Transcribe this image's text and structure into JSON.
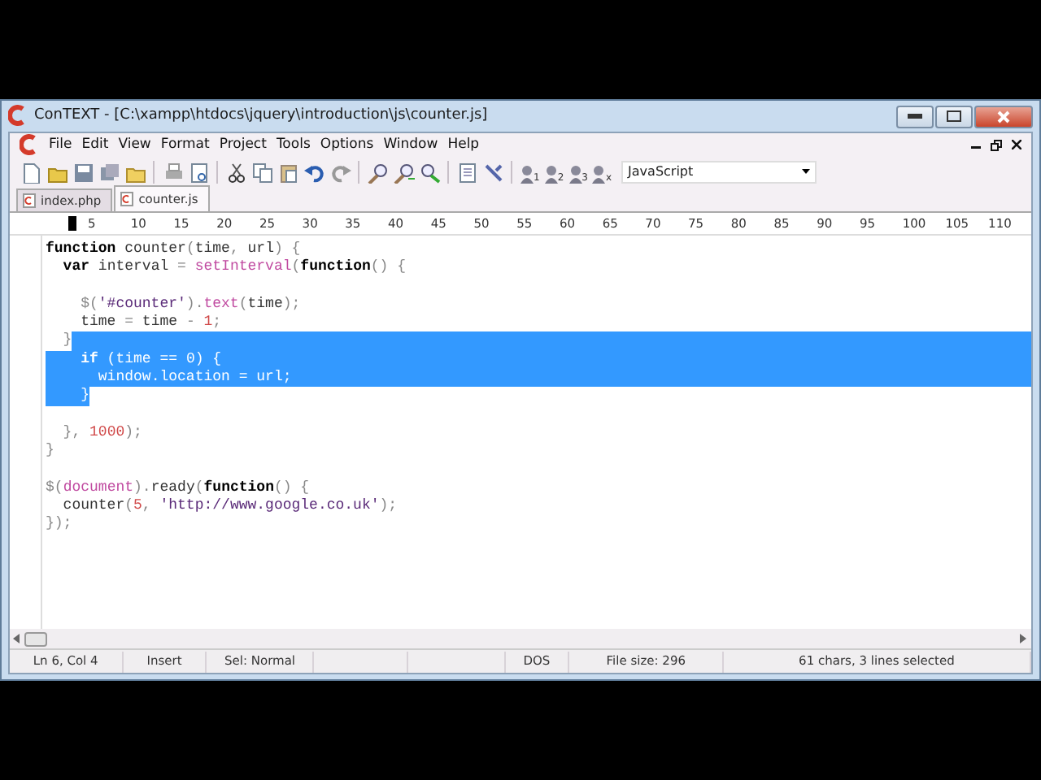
{
  "window": {
    "title": "ConTEXT - [C:\\xampp\\htdocs\\jquery\\introduction\\js\\counter.js]"
  },
  "menu": [
    "File",
    "Edit",
    "View",
    "Format",
    "Project",
    "Tools",
    "Options",
    "Window",
    "Help"
  ],
  "toolbar": {
    "user_tools": [
      "1",
      "2",
      "3",
      "x"
    ],
    "highlighter": "JavaScript"
  },
  "tabs": [
    {
      "label": "index.php",
      "selected": false
    },
    {
      "label": "counter.js",
      "selected": true
    }
  ],
  "ruler": [
    "5",
    "10",
    "15",
    "20",
    "25",
    "30",
    "35",
    "40",
    "45",
    "50",
    "55",
    "60",
    "65",
    "70",
    "75",
    "80",
    "85",
    "90",
    "95",
    "100",
    "105",
    "110"
  ],
  "editor": {
    "lines": [
      {
        "eol_selected": false,
        "tokens": [
          {
            "text": "function",
            "kind": "keyword",
            "selected": false
          },
          {
            "text": " counter",
            "kind": "ident",
            "selected": false
          },
          {
            "text": "(",
            "kind": "punct",
            "selected": false
          },
          {
            "text": "time",
            "kind": "ident",
            "selected": false
          },
          {
            "text": ", ",
            "kind": "punct",
            "selected": false
          },
          {
            "text": "url",
            "kind": "ident",
            "selected": false
          },
          {
            "text": ") {",
            "kind": "punct",
            "selected": false
          }
        ]
      },
      {
        "eol_selected": false,
        "tokens": [
          {
            "text": "  var",
            "kind": "keyword",
            "selected": false
          },
          {
            "text": " interval ",
            "kind": "ident",
            "selected": false
          },
          {
            "text": "= ",
            "kind": "punct",
            "selected": false
          },
          {
            "text": "setInterval",
            "kind": "builtin",
            "selected": false
          },
          {
            "text": "(",
            "kind": "punct",
            "selected": false
          },
          {
            "text": "function",
            "kind": "keyword",
            "selected": false
          },
          {
            "text": "() {",
            "kind": "punct",
            "selected": false
          }
        ]
      },
      {
        "eol_selected": false
      },
      {
        "eol_selected": false,
        "tokens": [
          {
            "text": "    $(",
            "kind": "punct",
            "selected": false
          },
          {
            "text": "'#counter'",
            "kind": "string",
            "selected": false
          },
          {
            "text": ").",
            "kind": "punct",
            "selected": false
          },
          {
            "text": "text",
            "kind": "builtin",
            "selected": false
          },
          {
            "text": "(",
            "kind": "punct",
            "selected": false
          },
          {
            "text": "time",
            "kind": "ident",
            "selected": false
          },
          {
            "text": ");",
            "kind": "punct",
            "selected": false
          }
        ]
      },
      {
        "eol_selected": false,
        "tokens": [
          {
            "text": "    time ",
            "kind": "ident",
            "selected": false
          },
          {
            "text": "= ",
            "kind": "punct",
            "selected": false
          },
          {
            "text": "time ",
            "kind": "ident",
            "selected": false
          },
          {
            "text": "- ",
            "kind": "punct",
            "selected": false
          },
          {
            "text": "1",
            "kind": "number",
            "selected": false
          },
          {
            "text": ";",
            "kind": "punct",
            "selected": false
          }
        ]
      },
      {
        "eol_selected": true,
        "tokens": [
          {
            "text": "  }",
            "kind": "punct",
            "selected": false
          }
        ]
      },
      {
        "eol_selected": true,
        "tokens": [
          {
            "text": "    if",
            "kind": "keyword",
            "selected": true
          },
          {
            "text": " (",
            "kind": "punct",
            "selected": true
          },
          {
            "text": "time ",
            "kind": "ident",
            "selected": true
          },
          {
            "text": "== ",
            "kind": "punct",
            "selected": true
          },
          {
            "text": "0",
            "kind": "number",
            "selected": true
          },
          {
            "text": ") {",
            "kind": "punct",
            "selected": true
          }
        ]
      },
      {
        "eol_selected": true,
        "tokens": [
          {
            "text": "      window",
            "kind": "ident",
            "selected": true
          },
          {
            "text": ".",
            "kind": "punct",
            "selected": true
          },
          {
            "text": "location ",
            "kind": "ident",
            "selected": true
          },
          {
            "text": "= ",
            "kind": "punct",
            "selected": true
          },
          {
            "text": "url",
            "kind": "ident",
            "selected": true
          },
          {
            "text": ";",
            "kind": "punct",
            "selected": true
          }
        ]
      },
      {
        "eol_selected": false,
        "tokens": [
          {
            "text": "    }",
            "kind": "punct",
            "selected": true
          }
        ]
      },
      {
        "eol_selected": false
      },
      {
        "eol_selected": false,
        "tokens": [
          {
            "text": "  }, ",
            "kind": "punct",
            "selected": false
          },
          {
            "text": "1000",
            "kind": "number",
            "selected": false
          },
          {
            "text": ");",
            "kind": "punct",
            "selected": false
          }
        ]
      },
      {
        "eol_selected": false,
        "tokens": [
          {
            "text": "}",
            "kind": "punct",
            "selected": false
          }
        ]
      },
      {
        "eol_selected": false
      },
      {
        "eol_selected": false,
        "tokens": [
          {
            "text": "$(",
            "kind": "punct",
            "selected": false
          },
          {
            "text": "document",
            "kind": "builtin",
            "selected": false
          },
          {
            "text": ").",
            "kind": "punct",
            "selected": false
          },
          {
            "text": "ready",
            "kind": "ident",
            "selected": false
          },
          {
            "text": "(",
            "kind": "punct",
            "selected": false
          },
          {
            "text": "function",
            "kind": "keyword",
            "selected": false
          },
          {
            "text": "() {",
            "kind": "punct",
            "selected": false
          }
        ]
      },
      {
        "eol_selected": false,
        "tokens": [
          {
            "text": "  counter",
            "kind": "ident",
            "selected": false
          },
          {
            "text": "(",
            "kind": "punct",
            "selected": false
          },
          {
            "text": "5",
            "kind": "number",
            "selected": false
          },
          {
            "text": ", ",
            "kind": "punct",
            "selected": false
          },
          {
            "text": "'http://www.google.co.uk'",
            "kind": "string",
            "selected": false
          },
          {
            "text": ");",
            "kind": "punct",
            "selected": false
          }
        ]
      },
      {
        "eol_selected": false,
        "tokens": [
          {
            "text": "});",
            "kind": "punct",
            "selected": false
          }
        ]
      }
    ]
  },
  "status_bar": [
    "Ln 6, Col 4",
    "Insert",
    "Sel: Normal",
    "DOS",
    "File size: 296",
    "61 chars, 3 lines selected"
  ]
}
